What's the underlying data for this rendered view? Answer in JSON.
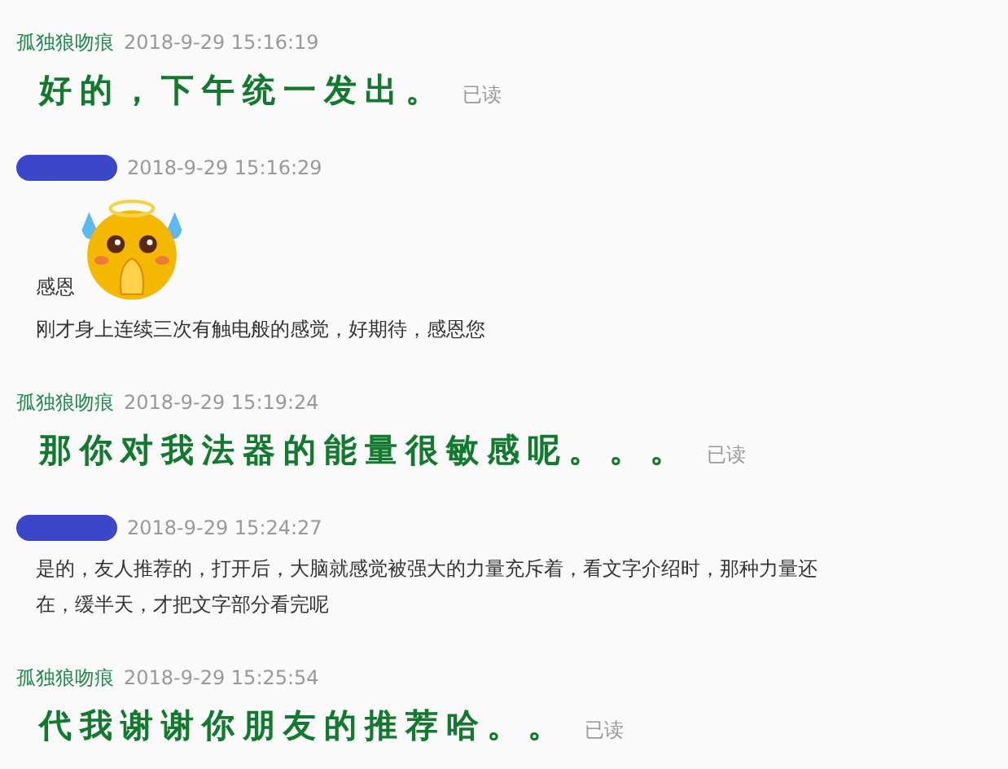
{
  "messages": [
    {
      "kind": "outgoing",
      "sender": {
        "name": "孤独狼吻痕"
      },
      "time": "2018-9-29 15:16:19",
      "read": "已读",
      "contents": [
        {
          "kind": "text",
          "text": "好的，下午统一发出。"
        }
      ]
    },
    {
      "kind": "incoming",
      "sender": {
        "redacted": true
      },
      "time": "2018-9-29 15:16:29",
      "contents": [
        {
          "kind": "sticker",
          "caption": "感恩"
        },
        {
          "kind": "text",
          "text": "刚才身上连续三次有触电般的感觉，好期待，感恩您"
        }
      ]
    },
    {
      "kind": "outgoing",
      "sender": {
        "name": "孤独狼吻痕"
      },
      "time": "2018-9-29 15:19:24",
      "read": "已读",
      "contents": [
        {
          "kind": "text",
          "text": "那你对我法器的能量很敏感呢。。。"
        }
      ]
    },
    {
      "kind": "incoming",
      "sender": {
        "redacted": true
      },
      "time": "2018-9-29 15:24:27",
      "contents": [
        {
          "kind": "text",
          "text": "是的，友人推荐的，打开后，大脑就感觉被强大的力量充斥着，看文字介绍时，那种力量还在，缓半天，才把文字部分看完呢"
        }
      ]
    },
    {
      "kind": "outgoing",
      "sender": {
        "name": "孤独狼吻痕"
      },
      "time": "2018-9-29 15:25:54",
      "read": "已读",
      "contents": [
        {
          "kind": "text",
          "text": "代我谢谢你朋友的推荐哈。。"
        }
      ]
    }
  ]
}
